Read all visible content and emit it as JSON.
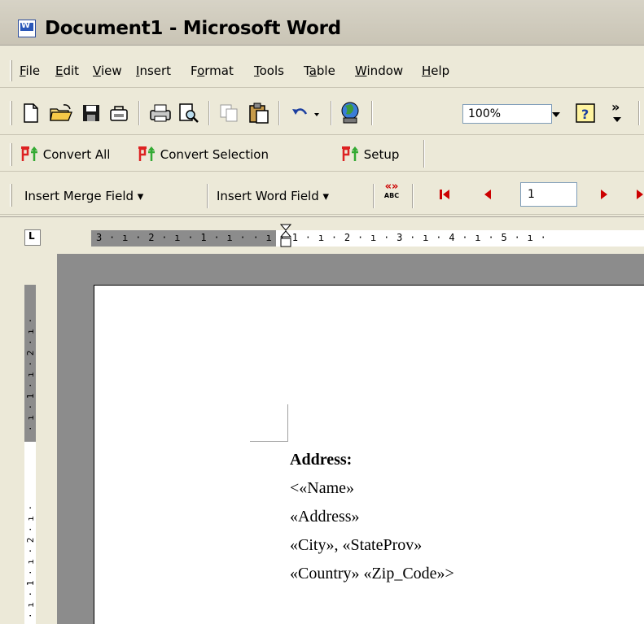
{
  "window": {
    "title": "Document1 - Microsoft Word",
    "app_icon": "word-icon"
  },
  "menu": {
    "items": [
      {
        "label": "File",
        "mnemonic": "F"
      },
      {
        "label": "Edit",
        "mnemonic": "E"
      },
      {
        "label": "View",
        "mnemonic": "V"
      },
      {
        "label": "Insert",
        "mnemonic": "I"
      },
      {
        "label": "Format",
        "mnemonic": "o"
      },
      {
        "label": "Tools",
        "mnemonic": "T"
      },
      {
        "label": "Table",
        "mnemonic": "a"
      },
      {
        "label": "Window",
        "mnemonic": "W"
      },
      {
        "label": "Help",
        "mnemonic": "H"
      }
    ]
  },
  "standard_toolbar": {
    "zoom": "100%",
    "icons": [
      "new-document-icon",
      "open-folder-icon",
      "save-icon",
      "permission-icon",
      "print-icon",
      "print-preview-icon",
      "copy-icon",
      "paste-icon",
      "undo-icon",
      "web-icon",
      "help-icon"
    ],
    "overflow": "»"
  },
  "convert_toolbar": {
    "convert_all": "Convert All",
    "convert_selection": "Convert Selection",
    "setup": "Setup"
  },
  "mail_merge_toolbar": {
    "insert_merge_field": "Insert Merge Field ▾",
    "insert_word_field": "Insert Word Field ▾",
    "merge_field_icon_top": "«»",
    "merge_field_icon_bottom": "ABC",
    "record_number": "1"
  },
  "ruler": {
    "tab_selector": "L",
    "horizontal_labels": "3 · ı · 2 · ı · 1 · ı ·    · ı · 1 · ı · 2 · ı · 3 · ı · 4 · ı · 5 · ı ·",
    "vertical_labels_top": "· ı · 1 · ı · 2 · ı ·",
    "vertical_labels_bottom": "· ı · 1 · ı · 2 · ı ·"
  },
  "document": {
    "heading": "Address:",
    "lines": [
      "<«Name»",
      "«Address»",
      "«City», «StateProv»",
      "«Country» «Zip_Code»>"
    ]
  }
}
